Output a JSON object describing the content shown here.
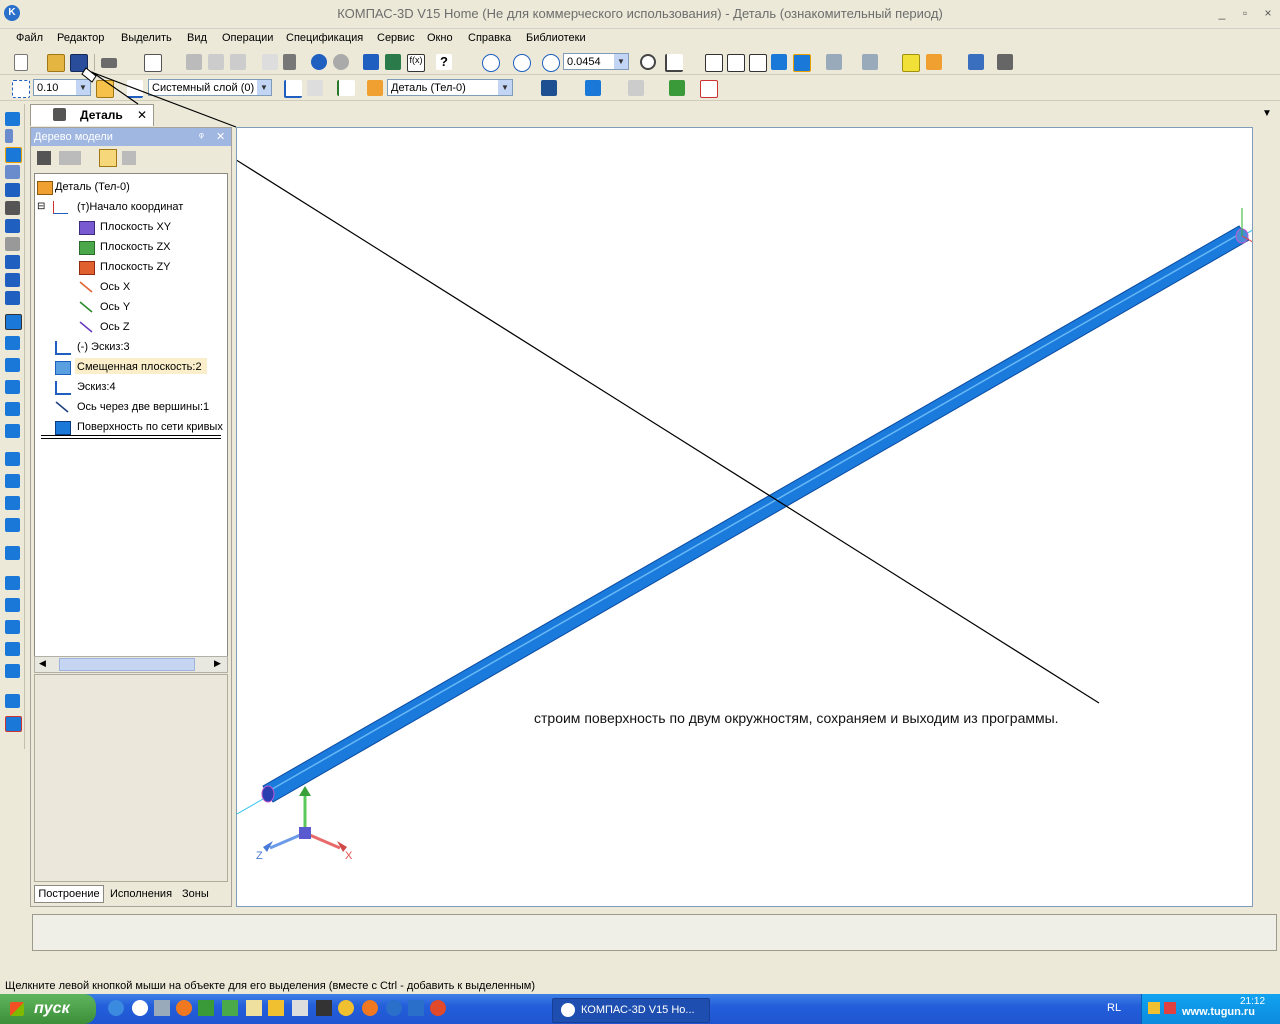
{
  "window": {
    "title": "КОМПАС-3D V15 Home (Не для коммерческого использования) - Деталь (ознакомительный период)",
    "controls": {
      "minimize": "_",
      "restore": "▫",
      "close": "×"
    }
  },
  "menu": [
    "Файл",
    "Редактор",
    "Выделить",
    "Вид",
    "Операции",
    "Спецификация",
    "Сервис",
    "Окно",
    "Справка",
    "Библиотеки"
  ],
  "toolbar": {
    "zoom_value": "0.0454",
    "step_value": "0.10",
    "layer_value": "Системный слой (0)",
    "part_value": "Деталь (Тел-0)"
  },
  "document_tab": {
    "label": "Деталь",
    "close": "✕"
  },
  "tree_panel": {
    "title": "Дерево модели",
    "pin": "ᵠ",
    "close": "✕",
    "nodes": [
      {
        "label": "Деталь (Тел-0)"
      },
      {
        "label": "(т)Начало координат",
        "expander": "⊟"
      },
      {
        "label": "Плоскость XY"
      },
      {
        "label": "Плоскость ZX"
      },
      {
        "label": "Плоскость ZY"
      },
      {
        "label": "Ось X"
      },
      {
        "label": "Ось Y"
      },
      {
        "label": "Ось Z"
      },
      {
        "label": "(-) Эскиз:3"
      },
      {
        "label": "Смещенная плоскость:2"
      },
      {
        "label": "Эскиз:4"
      },
      {
        "label": "Ось через две вершины:1"
      },
      {
        "label": "Поверхность по сети кривых"
      }
    ],
    "tabs": [
      "Построение",
      "Исполнения",
      "Зоны"
    ]
  },
  "viewport": {
    "annotation": "строим поверхность по двум окружностям, сохраняем и выходим из программы.",
    "axes": {
      "x": "X",
      "z": "Z"
    }
  },
  "status_text": "Щелкните левой кнопкой мыши на объекте для его выделения (вместе с Ctrl - добавить к выделенным)",
  "taskbar": {
    "start_label": "пуск",
    "active_app": "КОМПАС-3D V15 Ho...",
    "language": "RL",
    "clock": "21:12",
    "watermark": "www.tugun.ru"
  },
  "colors": {
    "rod": "#1a78d8",
    "titlebar": "#ece9d8",
    "taskbar": "#245edb",
    "highlight": "#fbefcb"
  }
}
